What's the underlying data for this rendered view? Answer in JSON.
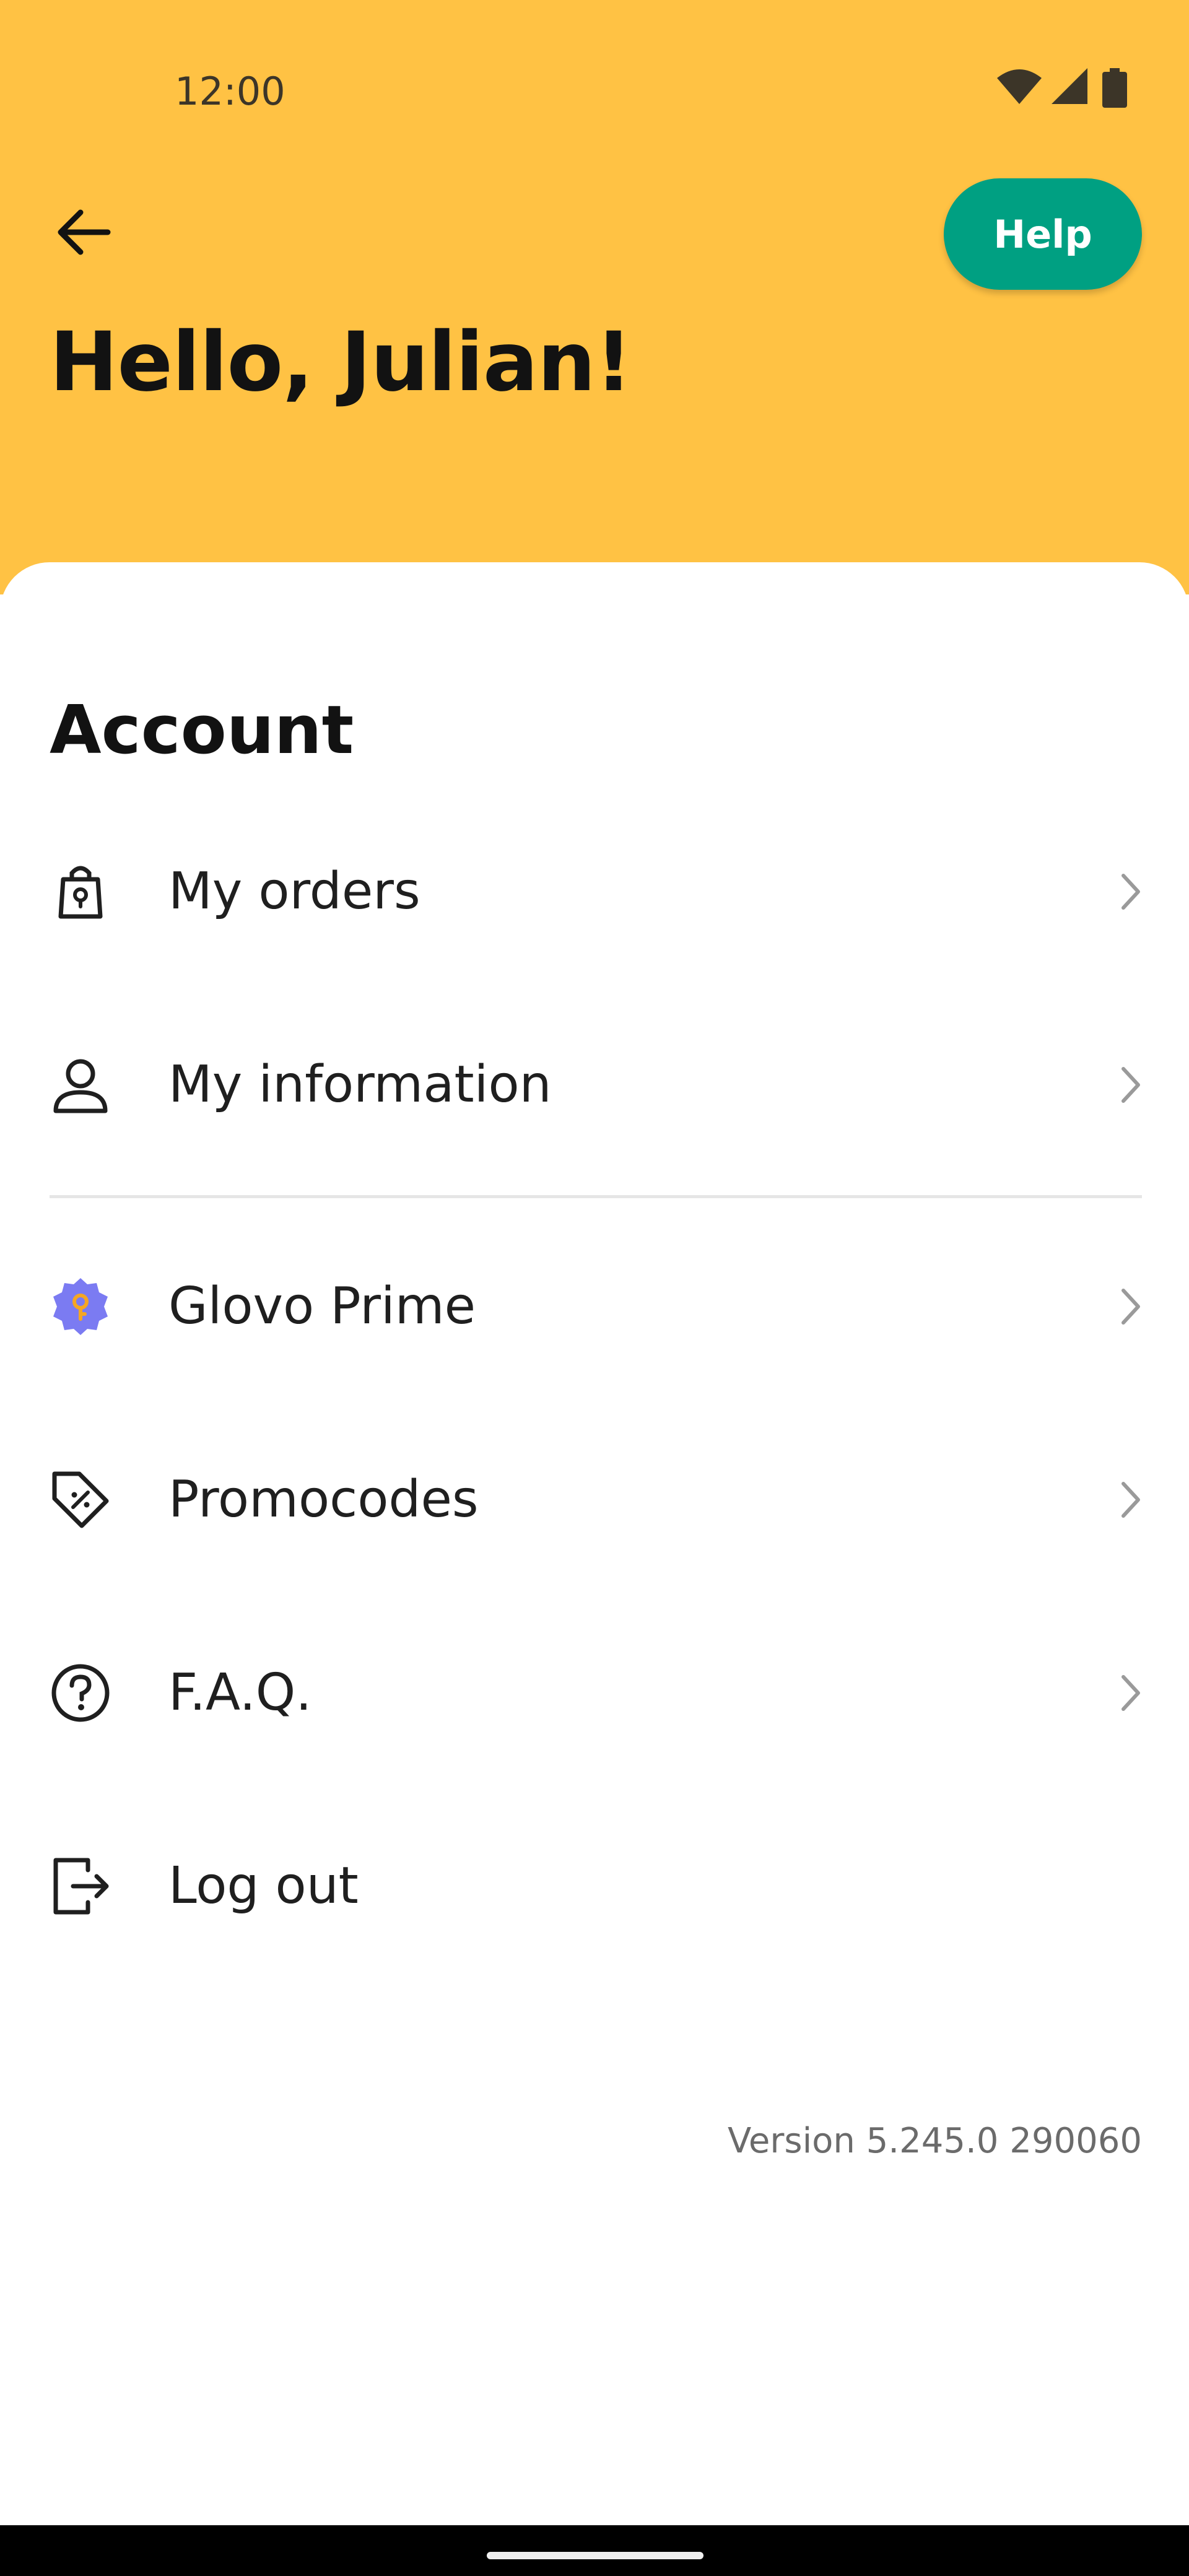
{
  "status_bar": {
    "time": "12:00",
    "icons": [
      "wifi-icon",
      "cellular-signal-icon",
      "battery-icon"
    ]
  },
  "header": {
    "back_icon": "arrow-left-icon",
    "help_label": "Help",
    "greeting": "Hello, Julian!"
  },
  "account": {
    "title": "Account",
    "items": [
      {
        "label": "My orders",
        "icon": "shopping-bag-icon"
      },
      {
        "label": "My information",
        "icon": "user-icon"
      },
      {
        "label": "Glovo Prime",
        "icon": "prime-badge-icon"
      },
      {
        "label": "Promocodes",
        "icon": "tag-percent-icon"
      },
      {
        "label": "F.A.Q.",
        "icon": "question-circle-icon"
      },
      {
        "label": "Log out",
        "icon": "logout-icon"
      }
    ]
  },
  "version": "Version 5.245.0 290060",
  "colors": {
    "header_bg": "#FFC244",
    "help_button": "#00A082",
    "prime_badge": "#7B7BF2",
    "prime_key": "#F5A623"
  }
}
